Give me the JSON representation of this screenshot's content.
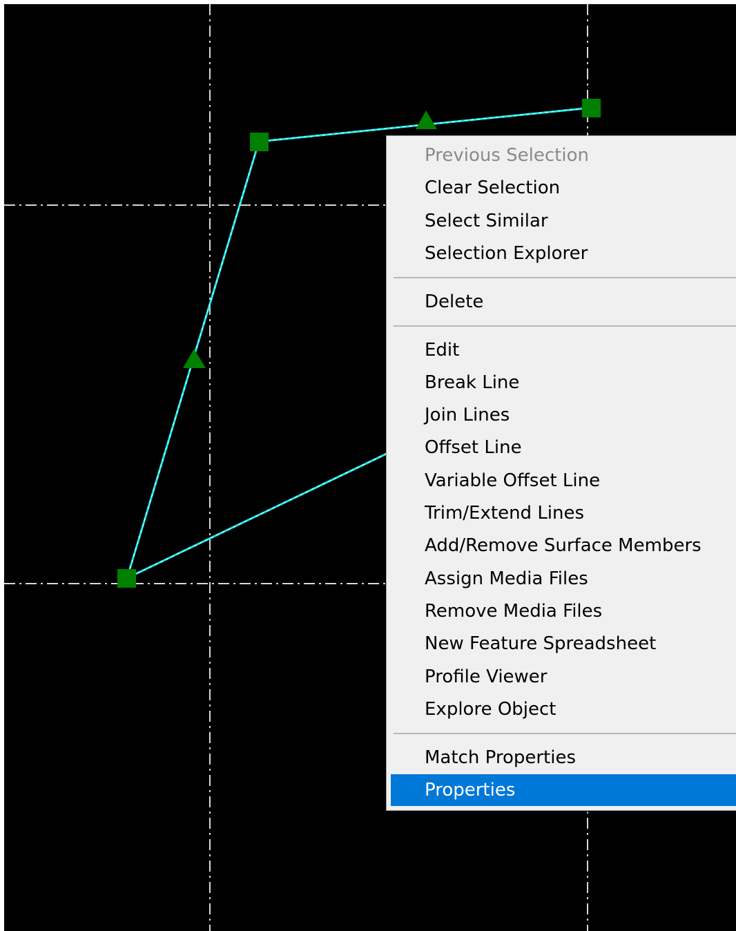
{
  "colors": {
    "canvas_background": "#000000",
    "grid_line": "#d8d8d8",
    "polyline": "#1ee8e8",
    "vertex_marker": "#008000",
    "menu_background": "#f0f0f0",
    "menu_highlight": "#0078d7",
    "menu_disabled_text": "#8a8a8a"
  },
  "canvas": {
    "vertex_marker_shape": "square",
    "midpoint_marker_shape": "triangle"
  },
  "context_menu": {
    "groups": [
      [
        {
          "label": "Previous Selection",
          "state": "disabled"
        },
        {
          "label": "Clear Selection",
          "state": "normal"
        },
        {
          "label": "Select Similar",
          "state": "normal"
        },
        {
          "label": "Selection Explorer",
          "state": "normal"
        }
      ],
      [
        {
          "label": "Delete",
          "state": "normal"
        }
      ],
      [
        {
          "label": "Edit",
          "state": "normal"
        },
        {
          "label": "Break Line",
          "state": "normal"
        },
        {
          "label": "Join Lines",
          "state": "normal"
        },
        {
          "label": "Offset Line",
          "state": "normal"
        },
        {
          "label": "Variable Offset Line",
          "state": "normal"
        },
        {
          "label": "Trim/Extend Lines",
          "state": "normal"
        },
        {
          "label": "Add/Remove Surface Members",
          "state": "normal"
        },
        {
          "label": "Assign Media Files",
          "state": "normal"
        },
        {
          "label": "Remove Media Files",
          "state": "normal"
        },
        {
          "label": "New Feature Spreadsheet",
          "state": "normal"
        },
        {
          "label": "Profile Viewer",
          "state": "normal"
        },
        {
          "label": "Explore Object",
          "state": "normal"
        }
      ],
      [
        {
          "label": "Match Properties",
          "state": "normal"
        },
        {
          "label": "Properties",
          "state": "highlighted"
        }
      ]
    ]
  }
}
